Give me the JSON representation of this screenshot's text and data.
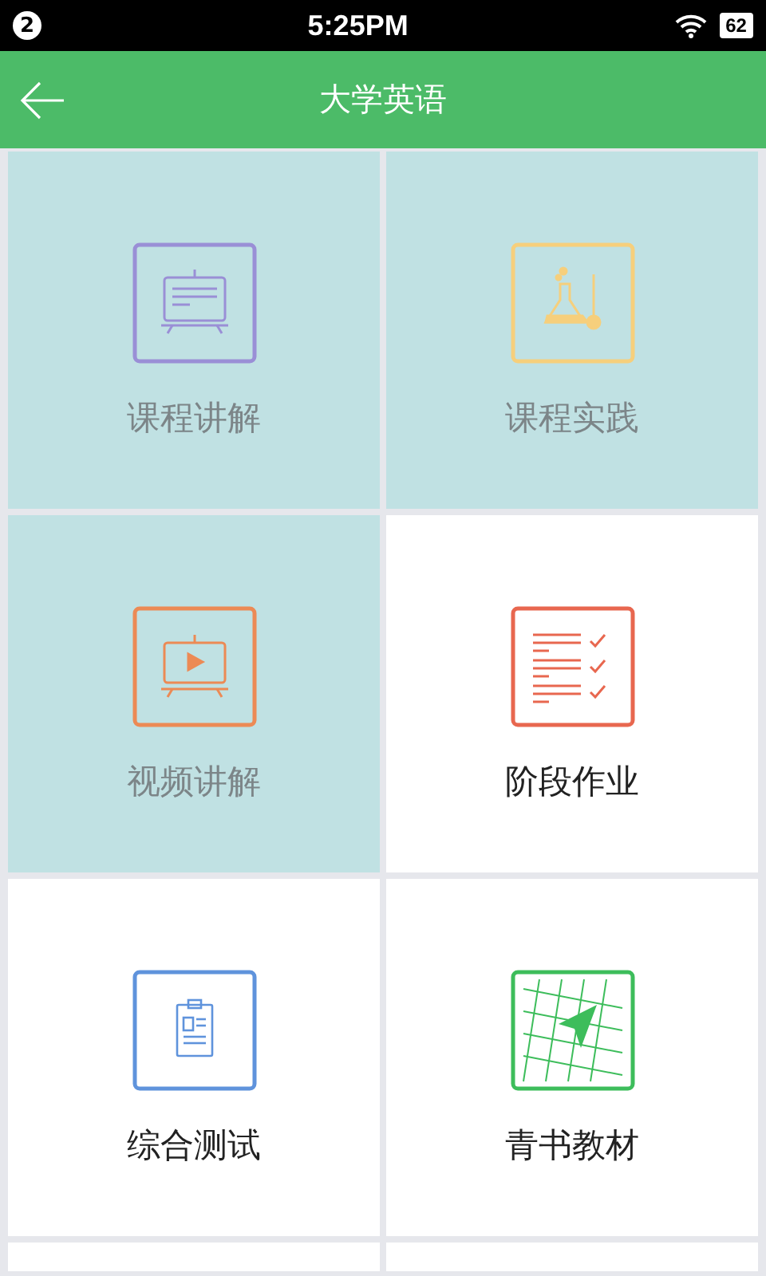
{
  "status_bar": {
    "notification_count": "2",
    "time": "5:25PM",
    "battery": "62"
  },
  "header": {
    "title": "大学英语"
  },
  "tiles": [
    {
      "label": "课程讲解",
      "kind": "lecture",
      "selected": true
    },
    {
      "label": "课程实践",
      "kind": "practice",
      "selected": true
    },
    {
      "label": "视频讲解",
      "kind": "video",
      "selected": true
    },
    {
      "label": "阶段作业",
      "kind": "homework",
      "selected": false
    },
    {
      "label": "综合测试",
      "kind": "test",
      "selected": false
    },
    {
      "label": "青书教材",
      "kind": "textbook",
      "selected": false
    }
  ]
}
